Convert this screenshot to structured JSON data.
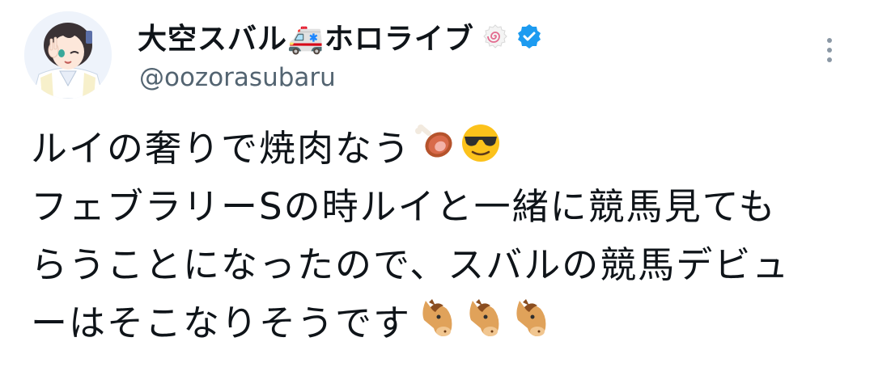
{
  "author": {
    "display_name": "大空スバル🚑ホロライブ",
    "handle": "@oozorasubaru",
    "verified_icon": "verified-checkmark-icon",
    "badge_icon": "naruto-swirl-icon",
    "avatar_icon": "vtuber-avatar"
  },
  "menu": {
    "icon": "more-vertical-icon"
  },
  "tweet": {
    "line1": "ルイの奢りで焼肉なう",
    "line2": "フェブラリーSの時ルイと一緒に競馬見ても",
    "line3": "らうことになったので、スバルの競馬デビュ",
    "line4": "ーはそこなりそうです",
    "emoji_line1": [
      "meat-on-bone-icon",
      "sunglasses-face-icon"
    ],
    "emoji_line4": [
      "horse-face-icon",
      "horse-face-icon",
      "horse-face-icon"
    ]
  },
  "colors": {
    "text": "#0f1419",
    "handle": "#536471",
    "verified": "#1d9bf0",
    "more_dots": "#8b98a5"
  }
}
